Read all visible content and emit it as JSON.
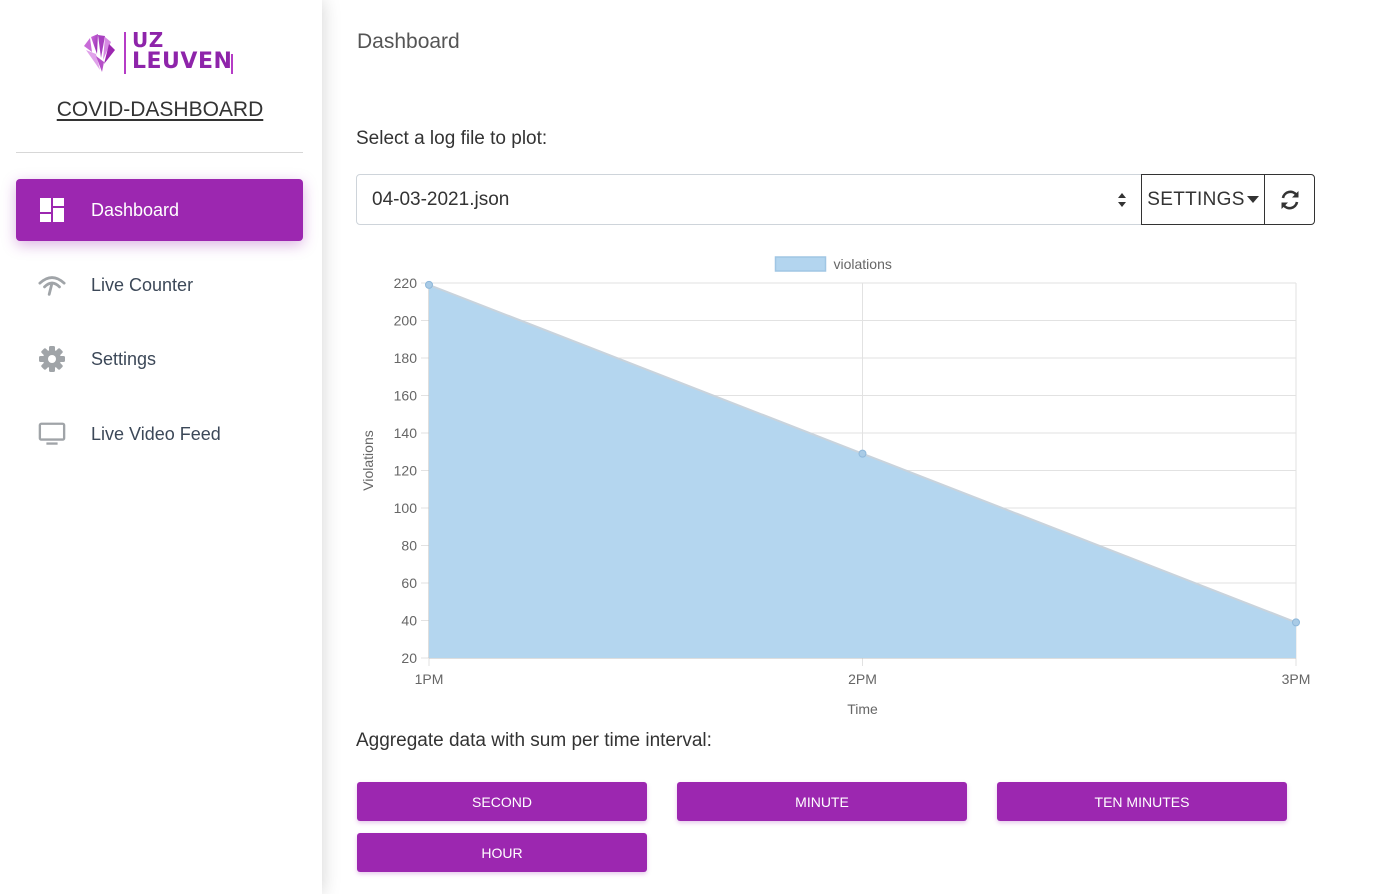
{
  "sidebar": {
    "logo": {
      "line1": "UZ",
      "line2": "LEUVEN",
      "icon": "uz-leuven-logo"
    },
    "brand": "COVID-DASHBOARD",
    "items": [
      {
        "label": "Dashboard",
        "icon": "dashboard-icon",
        "active": true
      },
      {
        "label": "Live Counter",
        "icon": "wifi-counter-icon",
        "active": false
      },
      {
        "label": "Settings",
        "icon": "gear-icon",
        "active": false
      },
      {
        "label": "Live Video Feed",
        "icon": "monitor-icon",
        "active": false
      }
    ]
  },
  "main": {
    "title": "Dashboard",
    "select_label": "Select a log file to plot:",
    "select_value": "04-03-2021.json",
    "settings_label": "SETTINGS",
    "refresh_icon": "refresh-icon",
    "aggregate_label": "Aggregate data with sum per time interval:",
    "aggregate_buttons": [
      "SECOND",
      "MINUTE",
      "TEN MINUTES",
      "HOUR"
    ]
  },
  "colors": {
    "accent": "#9c27b0",
    "area_fill": "#b3d5ef",
    "area_line": "#c9d3dc"
  },
  "chart_data": {
    "type": "area",
    "x": [
      "1PM",
      "2PM",
      "3PM"
    ],
    "series": [
      {
        "name": "violations",
        "values": [
          219,
          129,
          39
        ]
      }
    ],
    "xlabel": "Time",
    "ylabel": "Violations",
    "ylim": [
      20,
      220
    ],
    "yticks": [
      220,
      200,
      180,
      160,
      140,
      120,
      100,
      80,
      60,
      40,
      20
    ],
    "grid": true,
    "legend": "top-center"
  }
}
